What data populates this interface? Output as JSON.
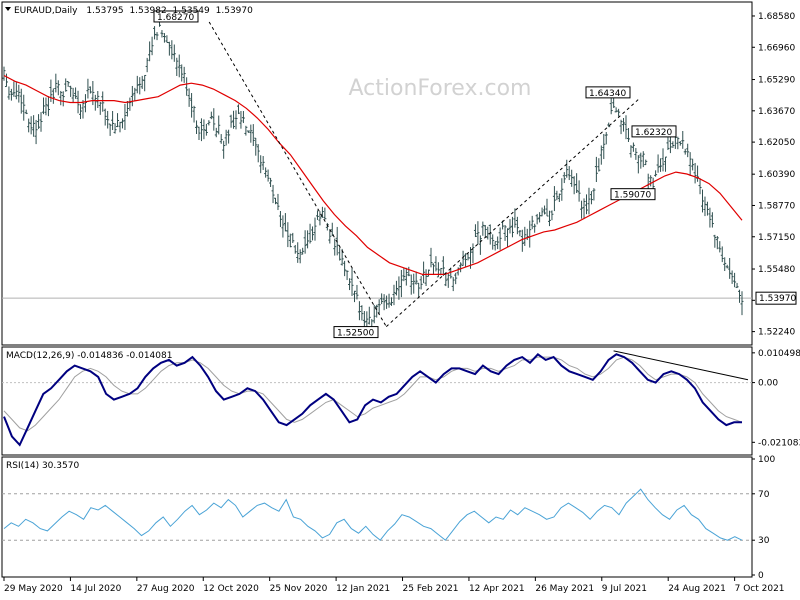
{
  "watermark": "ActionForex.com",
  "colors": {
    "bars": "#2f4f4f",
    "ma": "#e00000",
    "macd": "#000080",
    "signal": "#a0a0a0",
    "rsi": "#4aa3d6",
    "trendline": "#000000"
  },
  "chart_data": [
    {
      "type": "ohlc",
      "title": "EURAUD,Daily",
      "ohlc_values": [
        "1.53795",
        "1.53982",
        "1.53549",
        "1.53970"
      ],
      "current_price_label": "1.53970",
      "y_ticks": [
        "1.68580",
        "1.66960",
        "1.65290",
        "1.63670",
        "1.62050",
        "1.60390",
        "1.58770",
        "1.57150",
        "1.55480",
        "1.53860",
        "1.52240"
      ],
      "ylim": [
        1.5165,
        1.692
      ],
      "x_labels": [
        "29 May 2020",
        "14 Jul 2020",
        "27 Aug 2020",
        "12 Oct 2020",
        "25 Nov 2020",
        "12 Jan 2021",
        "25 Feb 2021",
        "12 Apr 2021",
        "26 May 2021",
        "9 Jul 2021",
        "24 Aug 2021",
        "7 Oct 2021"
      ],
      "annotations": [
        {
          "text": "1.68270",
          "value": 1.6827
        },
        {
          "text": "1.52500",
          "value": 1.525
        },
        {
          "text": "1.64340",
          "value": 1.6434
        },
        {
          "text": "1.62320",
          "value": 1.6232
        },
        {
          "text": "1.59070",
          "value": 1.5907
        }
      ],
      "close_path": [
        1.658,
        1.645,
        1.648,
        1.64,
        1.63,
        1.628,
        1.636,
        1.64,
        1.65,
        1.645,
        1.65,
        1.644,
        1.638,
        1.648,
        1.645,
        1.64,
        1.632,
        1.628,
        1.63,
        1.636,
        1.645,
        1.652,
        1.66,
        1.672,
        1.68,
        1.675,
        1.665,
        1.66,
        1.652,
        1.64,
        1.628,
        1.625,
        1.632,
        1.628,
        1.62,
        1.628,
        1.635,
        1.63,
        1.625,
        1.615,
        1.61,
        1.6,
        1.59,
        1.58,
        1.57,
        1.565,
        1.56,
        1.568,
        1.576,
        1.584,
        1.578,
        1.568,
        1.56,
        1.552,
        1.542,
        1.535,
        1.528,
        1.53,
        1.538,
        1.534,
        1.54,
        1.548,
        1.555,
        1.55,
        1.546,
        1.552,
        1.558,
        1.555,
        1.552,
        1.548,
        1.552,
        1.558,
        1.565,
        1.57,
        1.575,
        1.572,
        1.57,
        1.574,
        1.578,
        1.575,
        1.57,
        1.575,
        1.58,
        1.585,
        1.58,
        1.588,
        1.596,
        1.604,
        1.598,
        1.59,
        1.585,
        1.595,
        1.61,
        1.625,
        1.64,
        1.635,
        1.628,
        1.618,
        1.615,
        1.61,
        1.598,
        1.605,
        1.612,
        1.618,
        1.624,
        1.62,
        1.612,
        1.602,
        1.592,
        1.582,
        1.57,
        1.56,
        1.552,
        1.546,
        1.54
      ],
      "ma_path": [
        1.655,
        1.652,
        1.65,
        1.647,
        1.644,
        1.642,
        1.641,
        1.641,
        1.642,
        1.642,
        1.642,
        1.641,
        1.642,
        1.643,
        1.644,
        1.647,
        1.65,
        1.651,
        1.65,
        1.648,
        1.645,
        1.642,
        1.638,
        1.633,
        1.627,
        1.62,
        1.614,
        1.606,
        1.598,
        1.59,
        1.583,
        1.577,
        1.572,
        1.566,
        1.562,
        1.558,
        1.556,
        1.554,
        1.552,
        1.552,
        1.552,
        1.554,
        1.556,
        1.558,
        1.561,
        1.564,
        1.567,
        1.57,
        1.572,
        1.574,
        1.575,
        1.577,
        1.579,
        1.582,
        1.585,
        1.588,
        1.591,
        1.594,
        1.597,
        1.6,
        1.603,
        1.605,
        1.604,
        1.602,
        1.599,
        1.594,
        1.587,
        1.58
      ],
      "series": [
        {
          "name": "",
          "kind": "ohlc-bars"
        },
        {
          "name": "",
          "kind": "moving-average"
        }
      ]
    },
    {
      "type": "line",
      "title": "MACD(12,26,9) -0.014836 -0.014081",
      "y_ticks": [
        "0.010498",
        "0.00",
        "-0.021083"
      ],
      "ylim": [
        -0.0245,
        0.0115
      ],
      "macd": [
        -0.012,
        -0.019,
        -0.022,
        -0.016,
        -0.01,
        -0.004,
        -0.002,
        0.001,
        0.004,
        0.006,
        0.005,
        0.004,
        0.002,
        -0.004,
        -0.006,
        -0.005,
        -0.004,
        -0.002,
        0.002,
        0.005,
        0.007,
        0.008,
        0.006,
        0.007,
        0.009,
        0.006,
        0.002,
        -0.003,
        -0.006,
        -0.005,
        -0.004,
        -0.002,
        -0.003,
        -0.006,
        -0.01,
        -0.014,
        -0.015,
        -0.013,
        -0.011,
        -0.008,
        -0.006,
        -0.004,
        -0.006,
        -0.01,
        -0.014,
        -0.013,
        -0.008,
        -0.006,
        -0.007,
        -0.005,
        -0.004,
        -0.001,
        0.002,
        0.004,
        0.002,
        0.0,
        0.003,
        0.005,
        0.005,
        0.004,
        0.003,
        0.006,
        0.004,
        0.003,
        0.006,
        0.008,
        0.009,
        0.007,
        0.01,
        0.008,
        0.009,
        0.006,
        0.004,
        0.003,
        0.002,
        0.001,
        0.004,
        0.008,
        0.01,
        0.009,
        0.007,
        0.004,
        0.001,
        0.0,
        0.003,
        0.004,
        0.003,
        0.001,
        -0.002,
        -0.007,
        -0.01,
        -0.013,
        -0.015,
        -0.014,
        -0.014
      ],
      "signal": [
        -0.01,
        -0.013,
        -0.016,
        -0.017,
        -0.015,
        -0.012,
        -0.009,
        -0.006,
        -0.002,
        0.002,
        0.004,
        0.005,
        0.004,
        0.002,
        -0.001,
        -0.003,
        -0.004,
        -0.004,
        -0.002,
        0.001,
        0.004,
        0.006,
        0.007,
        0.007,
        0.008,
        0.007,
        0.005,
        0.002,
        -0.001,
        -0.003,
        -0.004,
        -0.003,
        -0.003,
        -0.004,
        -0.007,
        -0.01,
        -0.013,
        -0.014,
        -0.013,
        -0.011,
        -0.009,
        -0.007,
        -0.006,
        -0.008,
        -0.01,
        -0.012,
        -0.011,
        -0.009,
        -0.008,
        -0.007,
        -0.006,
        -0.004,
        -0.001,
        0.002,
        0.002,
        0.001,
        0.002,
        0.004,
        0.005,
        0.005,
        0.004,
        0.005,
        0.005,
        0.004,
        0.005,
        0.006,
        0.008,
        0.008,
        0.009,
        0.009,
        0.009,
        0.008,
        0.006,
        0.005,
        0.003,
        0.002,
        0.003,
        0.005,
        0.008,
        0.009,
        0.008,
        0.006,
        0.003,
        0.001,
        0.002,
        0.003,
        0.003,
        0.002,
        0.0,
        -0.004,
        -0.007,
        -0.01,
        -0.012,
        -0.013,
        -0.014
      ],
      "trendline": [
        0.0112,
        0.001
      ],
      "series": [
        {
          "name": "",
          "kind": "macd"
        },
        {
          "name": "",
          "kind": "signal"
        }
      ]
    },
    {
      "type": "line",
      "title": "RSI(14) 30.3570",
      "y_ticks": [
        "100",
        "70",
        "30",
        "0"
      ],
      "ylim": [
        0,
        100
      ],
      "levels": [
        70,
        30
      ],
      "rsi": [
        40,
        45,
        42,
        48,
        45,
        40,
        38,
        44,
        50,
        55,
        52,
        48,
        58,
        56,
        60,
        55,
        50,
        45,
        40,
        34,
        38,
        45,
        50,
        42,
        48,
        55,
        60,
        52,
        56,
        62,
        58,
        65,
        60,
        50,
        55,
        60,
        62,
        58,
        55,
        65,
        50,
        48,
        42,
        38,
        32,
        35,
        45,
        48,
        40,
        36,
        42,
        35,
        30,
        38,
        44,
        52,
        50,
        46,
        42,
        40,
        35,
        30,
        38,
        46,
        52,
        55,
        50,
        45,
        50,
        48,
        56,
        52,
        58,
        55,
        52,
        48,
        50,
        58,
        62,
        58,
        54,
        48,
        55,
        60,
        58,
        52,
        62,
        68,
        74,
        65,
        58,
        52,
        48,
        56,
        60,
        52,
        48,
        40,
        36,
        32,
        30,
        33,
        30
      ],
      "series": [
        {
          "name": "",
          "kind": "rsi"
        }
      ]
    }
  ]
}
